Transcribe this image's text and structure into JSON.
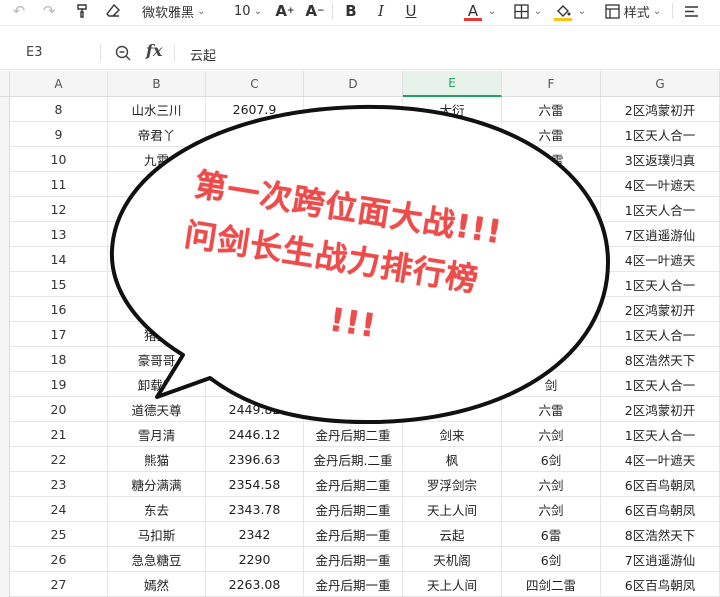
{
  "toolbar": {
    "font_name": "微软雅黑",
    "font_size": "10",
    "styles_label": "样式",
    "icons": [
      "undo-icon",
      "redo-icon",
      "format-painter-icon",
      "clear-format-icon",
      "increase-font-icon",
      "decrease-font-icon",
      "bold-icon",
      "italic-icon",
      "underline-icon",
      "font-color-icon",
      "borders-icon",
      "fill-color-icon",
      "cell-styles-icon",
      "align-left-icon"
    ],
    "font_color": "#e53935",
    "fill_color": "#f5c518"
  },
  "formula_bar": {
    "cell_ref": "E3",
    "fx_label": "fx",
    "value": "云起"
  },
  "columns": [
    "A",
    "B",
    "C",
    "D",
    "E",
    "F",
    "G"
  ],
  "active_column": "E",
  "rows": [
    {
      "n": "8",
      "b": "山水三川",
      "c": "2607.9",
      "d": "",
      "e": "大衍",
      "f": "六雷",
      "g": "2区鸿蒙初开"
    },
    {
      "n": "9",
      "b": "帝君丫",
      "c": "",
      "d": "",
      "e": "",
      "f": "六雷",
      "g": "1区天人合一"
    },
    {
      "n": "10",
      "b": "九霄",
      "c": "",
      "d": "",
      "e": "",
      "f": "六雷",
      "g": "3区返璞归真"
    },
    {
      "n": "11",
      "b": "",
      "c": "",
      "d": "",
      "e": "",
      "f": "六雷",
      "g": "4区一叶遮天"
    },
    {
      "n": "12",
      "b": "",
      "c": "",
      "d": "",
      "e": "",
      "f": "",
      "g": "1区天人合一"
    },
    {
      "n": "13",
      "b": "",
      "c": "",
      "d": "",
      "e": "",
      "f": "",
      "g": "7区逍遥游仙"
    },
    {
      "n": "14",
      "b": "",
      "c": "",
      "d": "",
      "e": "",
      "f": "",
      "g": "4区一叶遮天"
    },
    {
      "n": "15",
      "b": "",
      "c": "",
      "d": "",
      "e": "",
      "f": "",
      "g": "1区天人合一"
    },
    {
      "n": "16",
      "b": "",
      "c": "",
      "d": "",
      "e": "",
      "f": "",
      "g": "2区鸿蒙初开"
    },
    {
      "n": "17",
      "b": "猪猪",
      "c": "",
      "d": "",
      "e": "",
      "f": "",
      "g": "1区天人合一"
    },
    {
      "n": "18",
      "b": "豪哥哥",
      "c": "",
      "d": "",
      "e": "",
      "f": "",
      "g": "8区浩然天下"
    },
    {
      "n": "19",
      "b": "卸载刀",
      "c": "",
      "d": "",
      "e": "",
      "f": "剑",
      "g": "1区天人合一"
    },
    {
      "n": "20",
      "b": "道德天尊",
      "c": "2449.82",
      "d": "",
      "e": "",
      "f": "六雷",
      "g": "2区鸿蒙初开"
    },
    {
      "n": "21",
      "b": "雪月清",
      "c": "2446.12",
      "d": "金丹后期二重",
      "e": "剑来",
      "f": "六剑",
      "g": "1区天人合一"
    },
    {
      "n": "22",
      "b": "熊猫",
      "c": "2396.63",
      "d": "金丹后期.二重",
      "e": "枫",
      "f": "6剑",
      "g": "4区一叶遮天"
    },
    {
      "n": "23",
      "b": "糖分满满",
      "c": "2354.58",
      "d": "金丹后期二重",
      "e": "罗浮剑宗",
      "f": "六剑",
      "g": "6区百鸟朝凤"
    },
    {
      "n": "24",
      "b": "东去",
      "c": "2343.78",
      "d": "金丹后期二重",
      "e": "天上人间",
      "f": "六剑",
      "g": "6区百鸟朝凤"
    },
    {
      "n": "25",
      "b": "马扣斯",
      "c": "2342",
      "d": "金丹后期一重",
      "e": "云起",
      "f": "6雷",
      "g": "8区浩然天下"
    },
    {
      "n": "26",
      "b": "急急糖豆",
      "c": "2290",
      "d": "金丹后期一重",
      "e": "天机阁",
      "f": "6剑",
      "g": "7区逍遥游仙"
    },
    {
      "n": "27",
      "b": "嫣然",
      "c": "2263.08",
      "d": "金丹后期一重",
      "e": "天上人间",
      "f": "四剑二雷",
      "g": "6区百鸟朝凤"
    }
  ],
  "bubble": {
    "line1": "第一次跨位面大战!!!",
    "line2": "问剑长生战力排行榜",
    "line3": "!!!",
    "text_color": "#ee4b4b"
  }
}
